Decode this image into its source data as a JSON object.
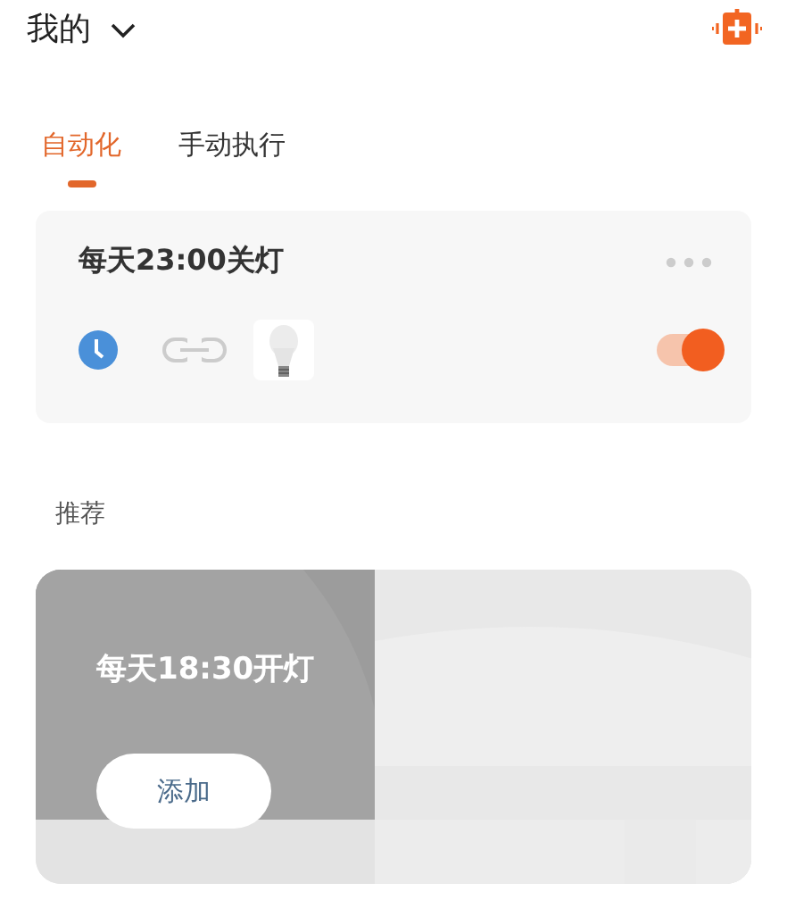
{
  "header": {
    "title": "我的"
  },
  "tabs": [
    {
      "label": "自动化",
      "selected": true
    },
    {
      "label": "手动执行",
      "selected": false
    }
  ],
  "automations": [
    {
      "title": "每天23:00关灯",
      "on": true
    }
  ],
  "section_title": "推荐",
  "recommendations": [
    {
      "title": "每天18:30开灯",
      "button": "添加"
    }
  ]
}
